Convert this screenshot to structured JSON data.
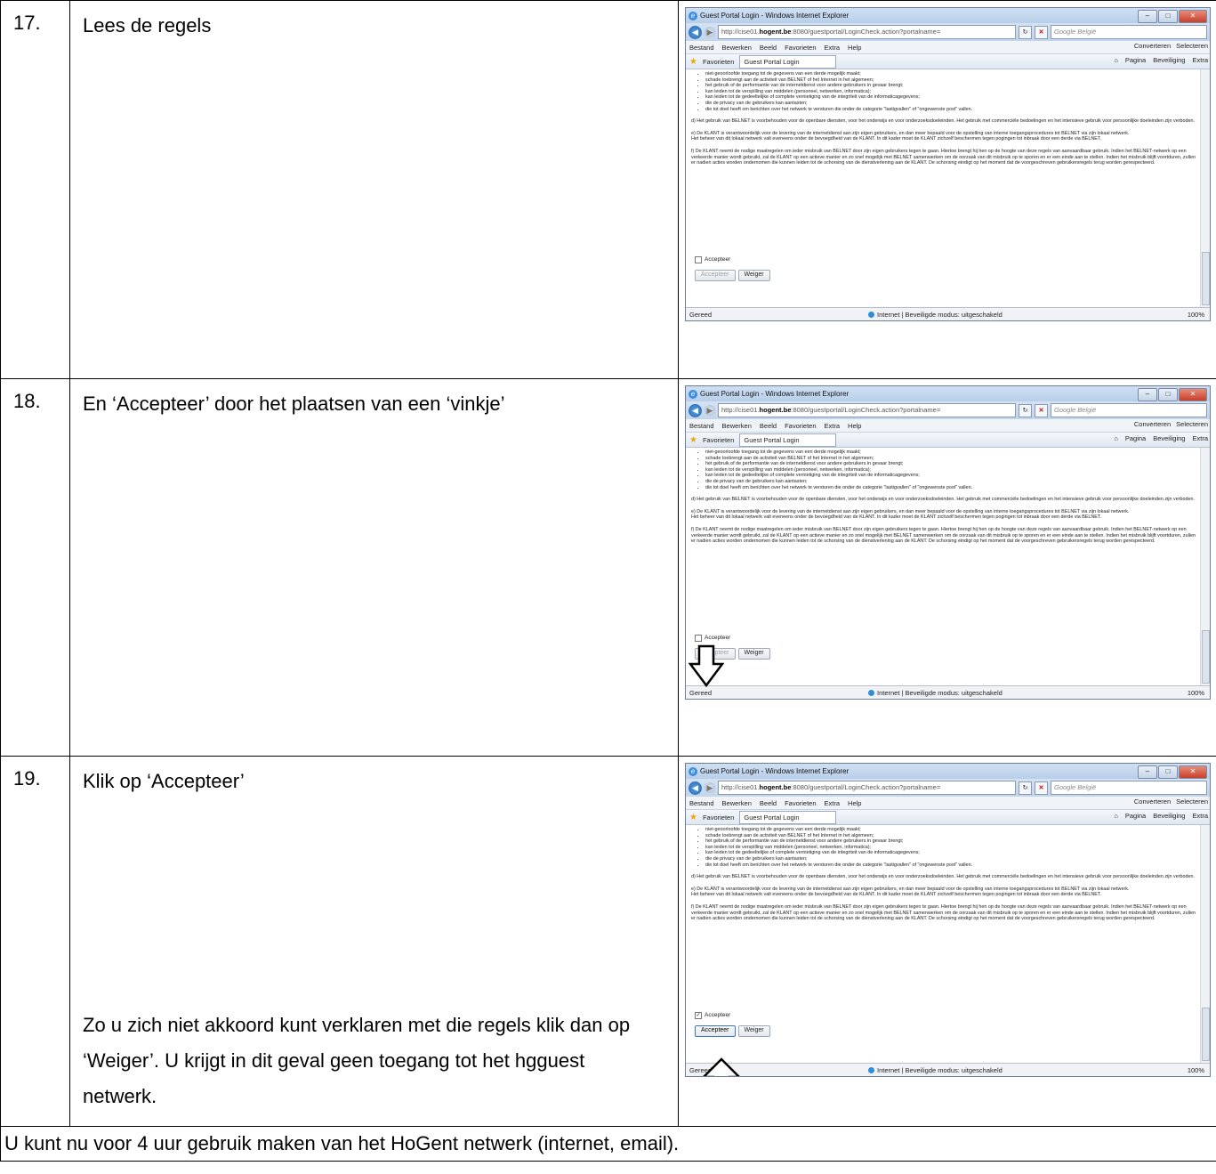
{
  "rows": [
    {
      "num": "17.",
      "text": "Lees de regels",
      "note": "",
      "checked": false,
      "arrow": "none"
    },
    {
      "num": "18.",
      "text": "En ‘Accepteer’ door het plaatsen van een ‘vinkje’",
      "note": "",
      "checked": false,
      "arrow": "down-to-checkbox"
    },
    {
      "num": "19.",
      "text": "Klik op ‘Accepteer’",
      "note": "Zo u zich niet akkoord kunt verklaren met die regels klik dan op ‘Weiger’. U krijgt in dit geval geen toegang tot het hgguest netwerk.",
      "checked": true,
      "arrow": "up-to-accept-button"
    }
  ],
  "footer": "U kunt  nu voor 4 uur gebruik maken van het HoGent netwerk (internet, email).",
  "browser": {
    "title": "Guest Portal Login - Windows Internet Explorer",
    "url_prefix": "http://cise01.",
    "url_host": "hogent.be",
    "url_suffix": ":8080/guestportal/LoginCheck.action?portalname=",
    "search_placeholder": "Google België",
    "menu": [
      "Bestand",
      "Bewerken",
      "Beeld",
      "Favorieten",
      "Extra",
      "Help"
    ],
    "menu_right": [
      "Converteren",
      "Selecteren"
    ],
    "favorites_label": "Favorieten",
    "tab_label": "Guest Portal Login",
    "command_items": [
      "Pagina",
      "Beveiliging",
      "Extra"
    ],
    "status_left": "Gereed",
    "status_zone": "Internet | Beveiligde modus: uitgeschakeld",
    "status_zoom": "100%"
  },
  "rules": {
    "bullets": [
      "niet-geoorloofde toegang tot de gegevens van een derde mogelijk maakt;",
      "schade toebrengt aan de activiteit van BELNET of het Internet in het algemeen;",
      "het gebruik of de performantie van de internetdienst voor andere gebruikers in gevaar brengt;",
      "kan leiden tot de verspilling van middelen (personeel, netwerken, informatica);",
      "kan leiden tot de gedeeltelijke of complete vernietiging van de integriteit van de informaticagegevens;",
      "die de privacy van de gebruikers kan aantasten;",
      "die tot doel heeft om berichten over het netwerk te versturen die onder de categorie \"lastigvallen\" of \"ongewenste post\" vallen."
    ],
    "d": "d) Het gebruik van BELNET is voorbehouden voor de openbare diensten, voor het onderwijs en voor onderzoeksdoeleinden. Het gebruik met commerciële bedoelingen en het intensieve gebruik voor persoonlijke doeleinden zijn verboden.",
    "e1": "e) De KLANT is verantwoordelijk voor de levering van de internetdienst aan zijn eigen gebruikers, en dan meer bepaald voor de opstelling van interne toegangsprocedures tot BELNET via zijn lokaal netwerk.",
    "e2": "Het beheer van dit lokaal netwerk valt eveneens onder de bevoegdheid van de KLANT. In dit kader moet de KLANT zichzelf beschermen tegen pogingen tot inbraak door een derde via BELNET.",
    "f": "f) De KLANT neemt de nodige maatregelen om ieder misbruik van BELNET door zijn eigen gebruikers tegen te gaan. Hiertoe brengt hij hen op de hoogte van deze regels van aanvaardbaar gebruik. Indien het BELNET-netwerk op een verkeerde manier wordt gebruikt, zal de KLANT op een actieve manier en zo snel mogelijk met BELNET samenwerken om de oorzaak van dit misbruik op te sporen en er een einde aan te stellen. Indien het misbruik blijft voortduren, zullen er nadien acties worden ondernomen die kunnen leiden tot de schorsing van de dienstverlening aan de KLANT. De schorsing eindigt op het moment dat de voorgeschreven gebruikersregels terug worden gerespecteerd."
  },
  "form": {
    "checkbox_label": "Accepteer",
    "accept_button": "Accepteer",
    "reject_button": "Weiger"
  }
}
